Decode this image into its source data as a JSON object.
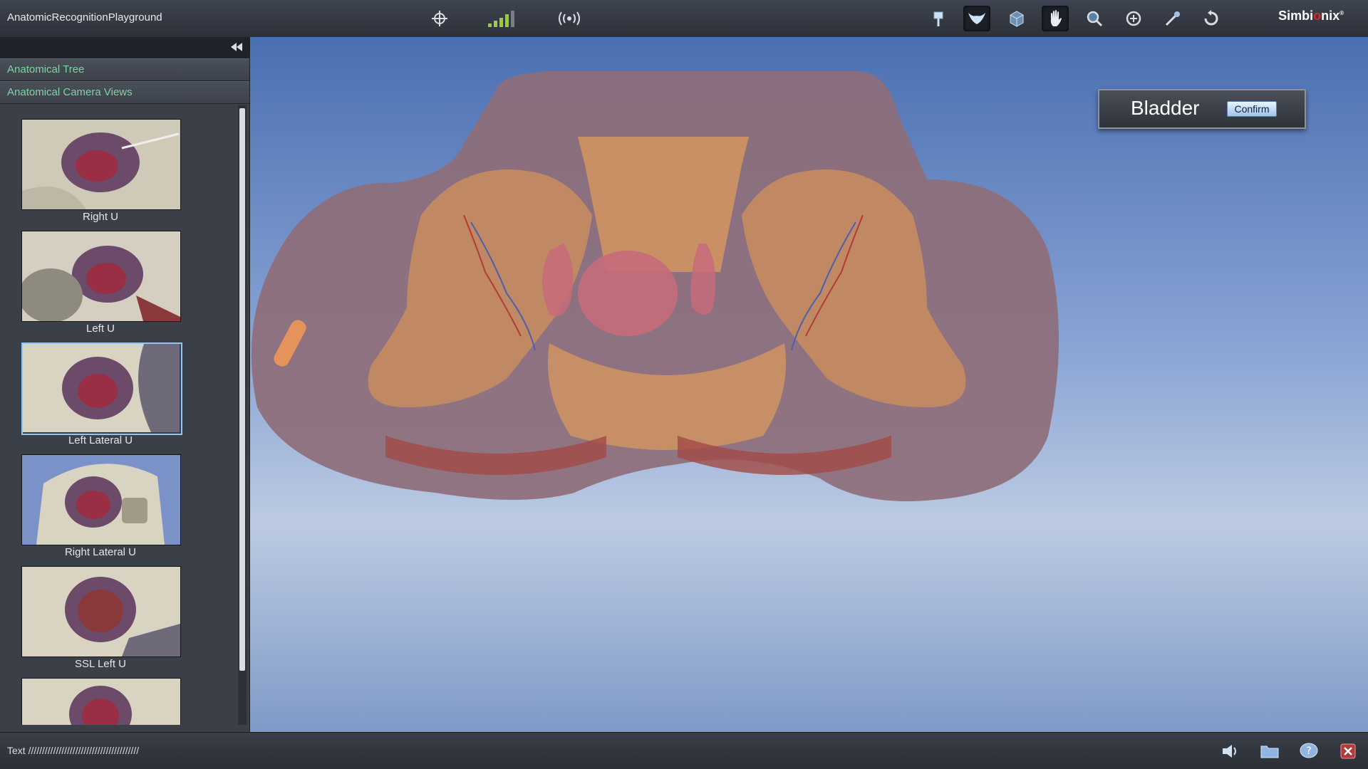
{
  "app": {
    "title": "AnatomicRecognitionPlayground",
    "brand_prefix": "Simbi",
    "brand_o": "o",
    "brand_suffix": "nix",
    "brand_mark": "®"
  },
  "toolbar_center": [
    {
      "icon": "crosshair-icon"
    },
    {
      "icon": "signal-strength-icon"
    },
    {
      "icon": "broadcast-icon"
    }
  ],
  "toolbar_right": [
    {
      "icon": "pin-icon"
    },
    {
      "icon": "pelvis-view-icon",
      "active": true
    },
    {
      "icon": "cube-view-icon"
    },
    {
      "icon": "hand-pan-icon",
      "active": true
    },
    {
      "icon": "zoom-icon"
    },
    {
      "icon": "rotate-icon"
    },
    {
      "icon": "pick-tool-icon"
    },
    {
      "icon": "reset-icon"
    }
  ],
  "sidebar": {
    "sections": [
      "Anatomical Tree",
      "Anatomical Camera Views"
    ],
    "views": [
      {
        "label": "Right U"
      },
      {
        "label": "Left U"
      },
      {
        "label": "Left Lateral U",
        "selected": true
      },
      {
        "label": "Right Lateral U"
      },
      {
        "label": "SSL Left U"
      },
      {
        "label": ""
      }
    ]
  },
  "dialog": {
    "organ": "Bladder",
    "confirm_label": "Confirm"
  },
  "status": {
    "text": "Text ////////////////////////////////////////"
  },
  "bottom_icons": [
    "speaker-icon",
    "folder-icon",
    "help-icon",
    "close-icon"
  ],
  "colors": {
    "accent_green": "#7fd3a0",
    "selection_blue": "#8ec7ff",
    "brand_red": "#d12b2b"
  }
}
